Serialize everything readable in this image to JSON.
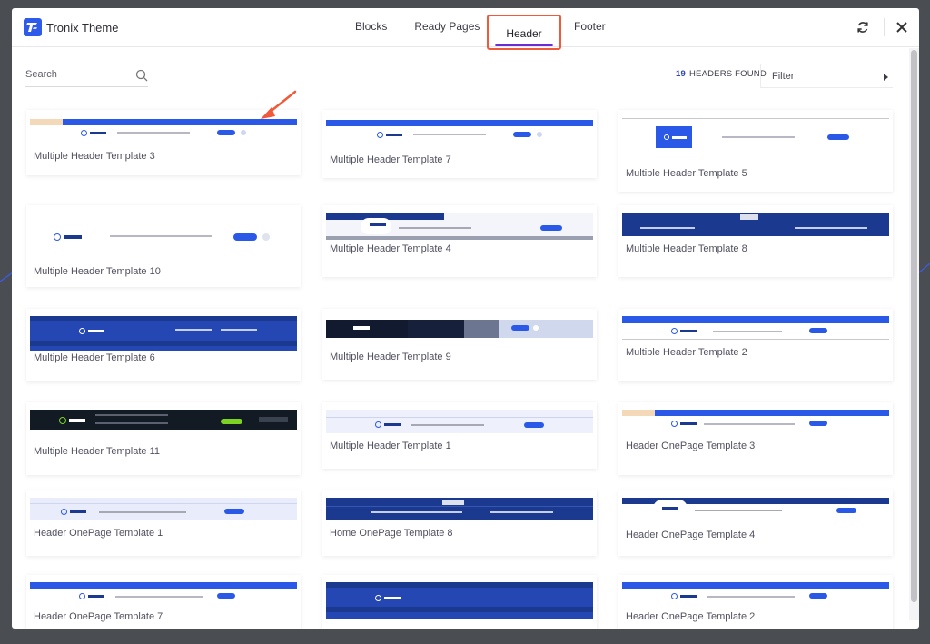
{
  "brand": {
    "name": "Tronix Theme"
  },
  "tabs": [
    {
      "label": "Blocks"
    },
    {
      "label": "Ready Pages"
    },
    {
      "label": "Header"
    },
    {
      "label": "Footer"
    }
  ],
  "search": {
    "placeholder": "Search"
  },
  "results": {
    "count": "19",
    "label": "HEADERS FOUND"
  },
  "filter": {
    "label": "Filter"
  },
  "cards": [
    {
      "title": "Multiple Header Template 3"
    },
    {
      "title": "Multiple Header Template 7"
    },
    {
      "title": "Multiple Header Template 5"
    },
    {
      "title": "Multiple Header Template 10"
    },
    {
      "title": "Multiple Header Template 4"
    },
    {
      "title": "Multiple Header Template 8"
    },
    {
      "title": "Multiple Header Template 6"
    },
    {
      "title": "Multiple Header Template 9"
    },
    {
      "title": "Multiple Header Template 2"
    },
    {
      "title": "Multiple Header Template 11"
    },
    {
      "title": "Multiple Header Template 1"
    },
    {
      "title": "Header OnePage Template 3"
    },
    {
      "title": "Header OnePage Template 1"
    },
    {
      "title": "Home OnePage Template 8"
    },
    {
      "title": "Header OnePage Template 4"
    },
    {
      "title": "Header OnePage Template 7"
    },
    {
      "title": ""
    },
    {
      "title": "Header OnePage Template 2"
    }
  ],
  "colors": {
    "accent_blue": "#2a59e8",
    "dark_navy": "#1b3a8f",
    "active_underline": "#6b2bd6",
    "highlight_border": "#f05a3a",
    "count_blue": "#3247b8"
  },
  "icons": [
    "refresh-icon",
    "close-icon",
    "search-icon",
    "caret-right-icon",
    "logo-icon"
  ]
}
